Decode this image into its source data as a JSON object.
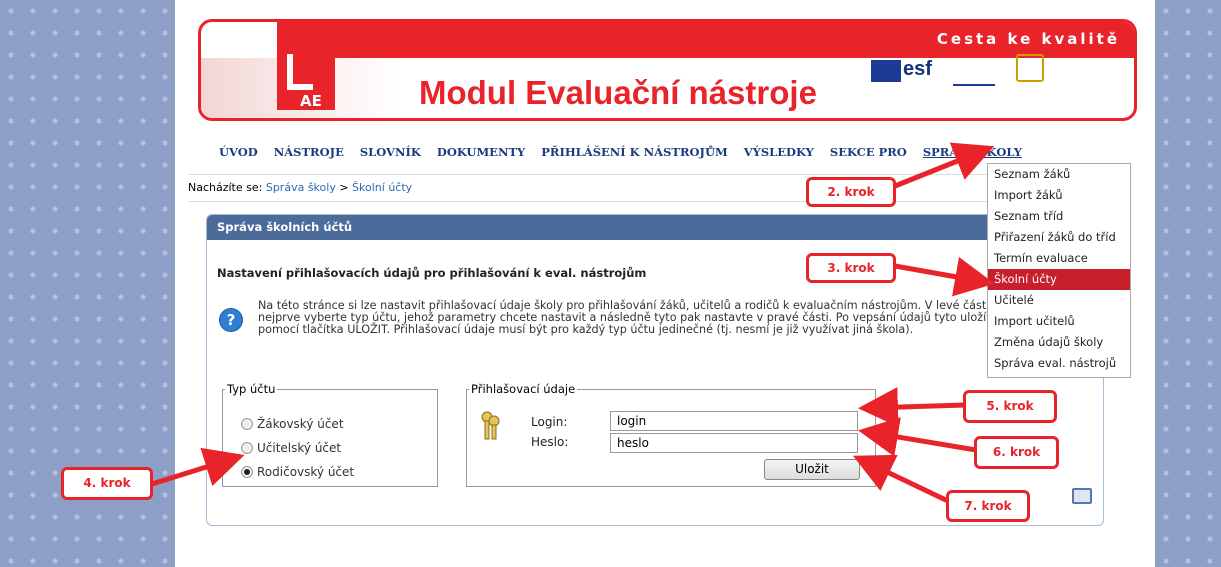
{
  "banner": {
    "motto": "Cesta ke kvalitě",
    "title": "Modul Evaluační nástroje",
    "logo_text": "AE",
    "esf": "esf"
  },
  "nav": [
    "ÚVOD",
    "NÁSTROJE",
    "SLOVNÍK",
    "DOKUMENTY",
    "PŘIHLÁŠENÍ K NÁSTROJŮM",
    "VÝSLEDKY",
    "SEKCE PRO",
    "SPRÁVA ŠKOLY"
  ],
  "breadcrumb": {
    "label": "Nacházíte se:",
    "item1": "Správa školy",
    "sep": ">",
    "item2": "Školní účty"
  },
  "panel": {
    "header": "Správa školních účtů",
    "section_title": "Nastavení přihlašovacích údajů pro přihlašování k eval. nástrojům",
    "help_icon": "?",
    "desc": "Na této stránce si lze nastavit přihlašovací údaje školy pro přihlašování žáků, učitelů a rodičů k evaluačním nástrojům. V levé části si nejprve vyberte typ účtu, jehož parametry chcete nastavit a následně tyto pak nastavte v pravé části. Po vepsání údajů tyto uložíte pomocí tlačítka ULOŽIT. Přihlašovací údaje musí být pro každý typ účtu jedinečné (tj. nesmí je již využívat jiná škola)."
  },
  "account_type": {
    "legend": "Typ účtu",
    "options": [
      "Žákovský účet",
      "Učitelský účet",
      "Rodičovský účet"
    ],
    "selected": 2
  },
  "login_box": {
    "legend": "Přihlašovací údaje",
    "login_label": "Login:",
    "login_value": "login",
    "password_label": "Heslo:",
    "password_value": "heslo",
    "save": "Uložit"
  },
  "dropdown": [
    "Seznam žáků",
    "Import žáků",
    "Seznam tříd",
    "Přiřazení žáků do tříd",
    "Termín evaluace",
    "Školní účty",
    "Učitelé",
    "Import učitelů",
    "Změna údajů školy",
    "Správa eval. nástrojů"
  ],
  "dropdown_selected": 5,
  "callouts": {
    "k2": "2. krok",
    "k3": "3. krok",
    "k4": "4. krok",
    "k5": "5. krok",
    "k6": "6. krok",
    "k7": "7. krok"
  },
  "colors": {
    "brand_red": "#e8242a",
    "nav_blue": "#1a3c7d",
    "panel_header": "#4b6b9b",
    "selected_menu": "#c71f2c",
    "side_bg": "#8d9fc6"
  }
}
